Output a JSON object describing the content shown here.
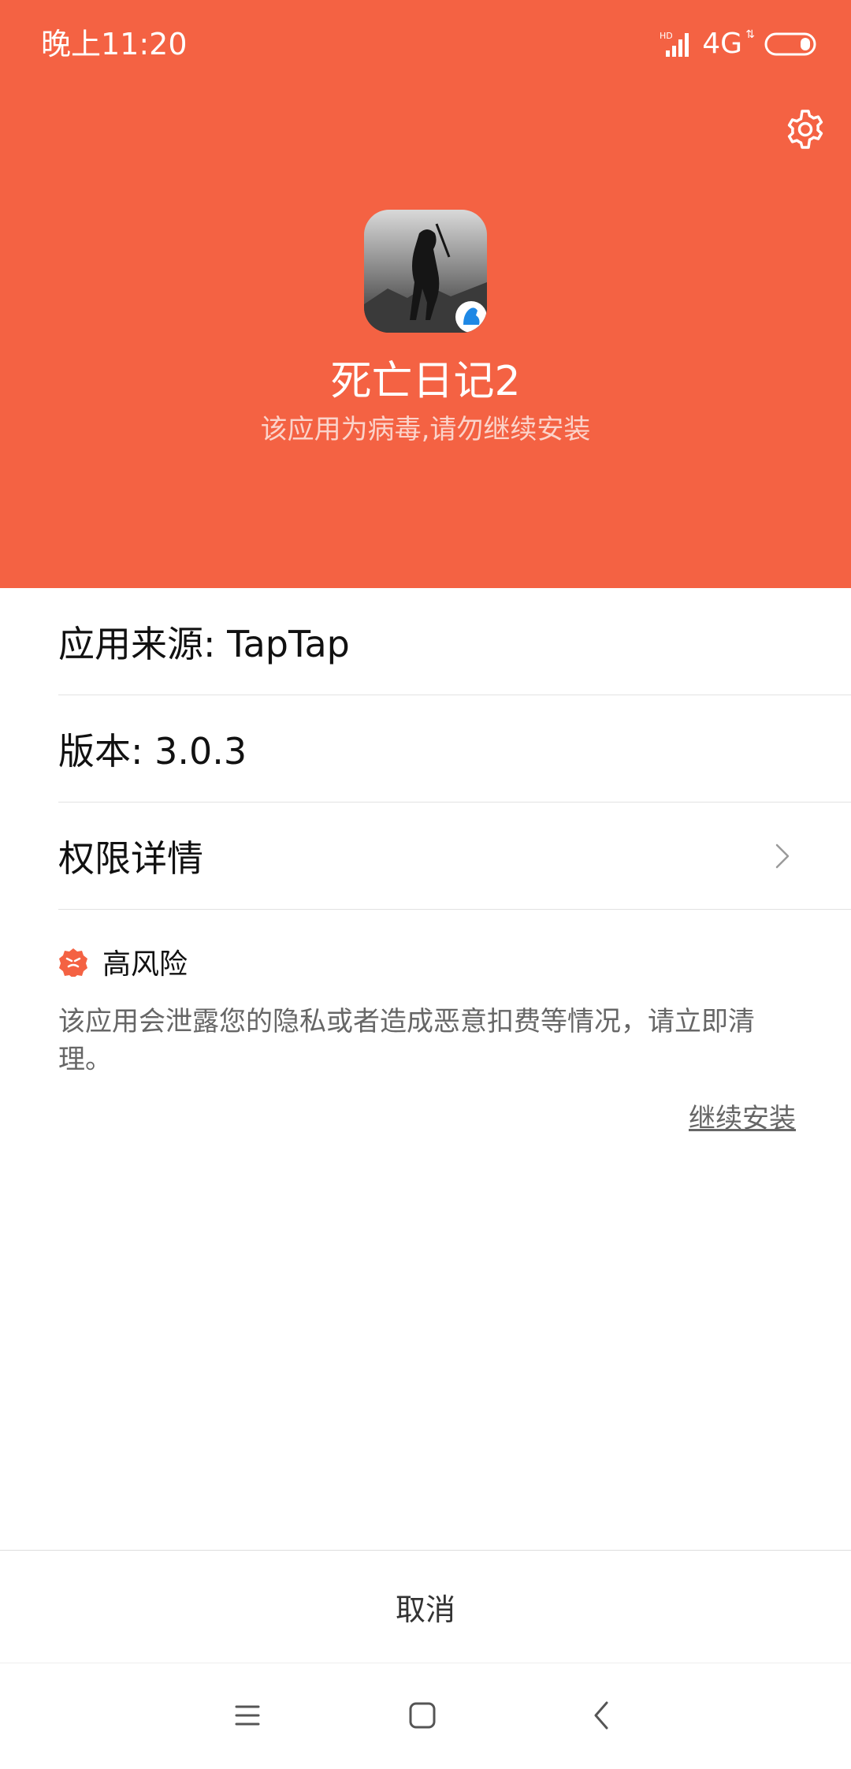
{
  "status_bar": {
    "time": "晚上11:20",
    "hd_label": "HD",
    "network_label": "4G"
  },
  "header": {
    "app_name": "死亡日记2",
    "warning_text": "该应用为病毒,请勿继续安装",
    "background_color": "#f46243"
  },
  "info_rows": [
    {
      "label": "应用来源: TapTap"
    },
    {
      "label": "版本: 3.0.3"
    },
    {
      "label": "权限详情"
    }
  ],
  "risk": {
    "level_label": "高风险",
    "description": "该应用会泄露您的隐私或者造成恶意扣费等情况，请立即清理。",
    "icon": "risk-shield-icon",
    "icon_color": "#f46243"
  },
  "actions": {
    "continue_install": "继续安装",
    "cancel": "取消"
  },
  "nav": {
    "icons": [
      "menu-icon",
      "home-icon",
      "back-icon"
    ]
  }
}
